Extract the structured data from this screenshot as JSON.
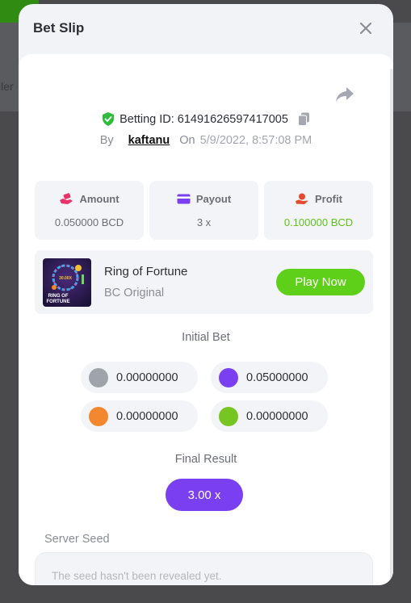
{
  "backdrop": {
    "partial_text": "ller"
  },
  "modal": {
    "title": "Bet Slip",
    "betting_id_label": "Betting ID:",
    "betting_id": "61491626597417005",
    "by_label": "By",
    "username": "kaftanu",
    "on_label": "On",
    "timestamp": "5/9/2022, 8:57:08 PM"
  },
  "stats": [
    {
      "label": "Amount",
      "value": "0.050000 BCD",
      "icon": "money-hand-icon",
      "icon_color": "#e8336a"
    },
    {
      "label": "Payout",
      "value": "3 x",
      "icon": "card-icon",
      "icon_color": "#7b3ff2"
    },
    {
      "label": "Profit",
      "value": "0.100000 BCD",
      "icon": "coin-hand-icon",
      "icon_color": "#e34a2f",
      "value_color": "#5fc21d"
    }
  ],
  "game": {
    "name": "Ring of Fortune",
    "subtitle": "BC Original",
    "play_label": "Play Now",
    "thumb_text_1": "RING OF",
    "thumb_text_2": "FORTUNE",
    "thumb_badge": "30.00X"
  },
  "initial_bet": {
    "label": "Initial Bet",
    "coins": [
      {
        "value": "0.00000000",
        "color": "#9ea3ac"
      },
      {
        "value": "0.05000000",
        "color": "#7b3ff2"
      },
      {
        "value": "0.00000000",
        "color": "#f2872f"
      },
      {
        "value": "0.00000000",
        "color": "#76c522"
      }
    ]
  },
  "final_result": {
    "label": "Final Result",
    "value": "3.00 x"
  },
  "server_seed": {
    "label": "Server Seed",
    "placeholder": "The seed hasn't been revealed yet."
  },
  "colors": {
    "accent_purple": "#7b3ff2",
    "accent_green": "#5fd019",
    "shield_green": "#2ebd3a"
  }
}
